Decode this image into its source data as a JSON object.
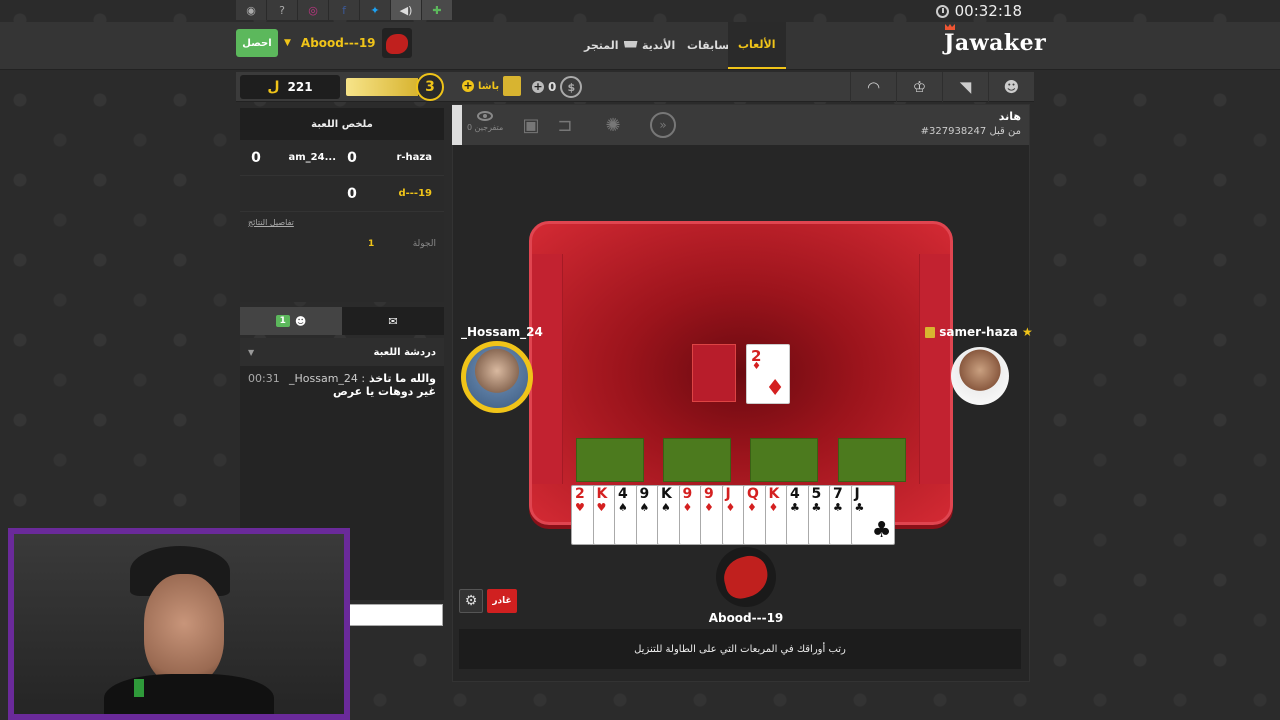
{
  "topbar": {
    "icons": [
      "globe-icon",
      "help-icon",
      "instagram-icon",
      "facebook-icon",
      "twitter-icon",
      "sound-icon",
      "gamepad-icon"
    ],
    "help_label": "?",
    "facebook_label": "f"
  },
  "clock": {
    "time": "00:32:18"
  },
  "nav": {
    "logo": "Jawaker",
    "games": "الألعاب",
    "competitions": "مسابقات",
    "clubs": "الأندية",
    "store": "المتجر",
    "get_button": "احصل",
    "username": "Abood---19"
  },
  "toolbar": {
    "coins": "221",
    "coin_symbol": "ل",
    "xp_percent": 80,
    "level": "3",
    "pasha": "باشا",
    "tokens": "0"
  },
  "summary": {
    "title": "ملخص اللعبة",
    "rows": [
      {
        "name_a": "r-haza",
        "score_a": "0",
        "name_b": "am_24...",
        "score_b": "0"
      },
      {
        "name_a": "d---19",
        "score_a": "0"
      }
    ],
    "details_link": "تفاصيل النتائج",
    "round_label": "الجولة",
    "round_value": "1"
  },
  "chat": {
    "players_count": "1",
    "header": "دردشة اللعبة",
    "messages": [
      {
        "time": "00:31",
        "author": "_Hossam_24 :",
        "text": "والله ما تاخذ غير دوهات يا عرص"
      }
    ]
  },
  "game": {
    "title": "هاند",
    "id_text": "#327938247 من قبل",
    "spectators": "0 متفرجين",
    "drawn_card": {
      "rank": "2",
      "suit": "♦",
      "color": "red"
    },
    "hand": [
      {
        "rank": "2",
        "suit": "♥",
        "color": "red"
      },
      {
        "rank": "K",
        "suit": "♥",
        "color": "red"
      },
      {
        "rank": "4",
        "suit": "♠",
        "color": "black"
      },
      {
        "rank": "9",
        "suit": "♠",
        "color": "black"
      },
      {
        "rank": "K",
        "suit": "♠",
        "color": "black"
      },
      {
        "rank": "9",
        "suit": "♦",
        "color": "red"
      },
      {
        "rank": "9",
        "suit": "♦",
        "color": "red"
      },
      {
        "rank": "J",
        "suit": "♦",
        "color": "red"
      },
      {
        "rank": "Q",
        "suit": "♦",
        "color": "red"
      },
      {
        "rank": "K",
        "suit": "♦",
        "color": "red"
      },
      {
        "rank": "4",
        "suit": "♣",
        "color": "black"
      },
      {
        "rank": "5",
        "suit": "♣",
        "color": "black"
      },
      {
        "rank": "7",
        "suit": "♣",
        "color": "black"
      },
      {
        "rank": "J",
        "suit": "♣",
        "color": "black"
      }
    ],
    "players": {
      "left": "_Hossam_24",
      "right": "samer-haza",
      "bottom": "Abood---19"
    },
    "leave_button": "غادر",
    "instructions": "رتب أوراقك في المربعات التي على الطاولة للتنزيل"
  },
  "colors": {
    "accent": "#f0c419",
    "table": "#c22230",
    "slot": "#4c7a1e",
    "webcam_border": "#6a2a9a"
  }
}
